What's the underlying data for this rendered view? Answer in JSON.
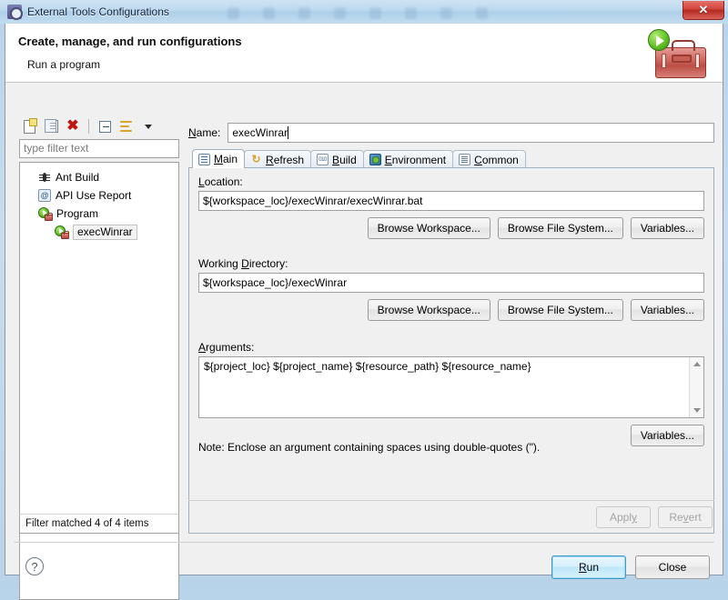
{
  "window": {
    "title": "External Tools Configurations",
    "title_icon": "external-tools-icon",
    "close_label": "✕"
  },
  "banner": {
    "title": "Create, manage, and run configurations",
    "subtitle": "Run a program",
    "art_icon": "toolbox-with-play-icon"
  },
  "tree_toolbar": {
    "buttons": [
      {
        "name": "new-launch-configuration",
        "icon": "new-document-icon"
      },
      {
        "name": "duplicate-launch-configuration",
        "icon": "copy-icon"
      },
      {
        "name": "delete-launch-configuration",
        "icon": "delete-red-x-icon",
        "glyph": "✖"
      },
      {
        "name": "collapse-all",
        "icon": "collapse-all-icon"
      },
      {
        "name": "filter-launch-configurations",
        "icon": "filter-icon"
      },
      {
        "name": "view-menu",
        "icon": "chevron-down-icon"
      }
    ]
  },
  "filter": {
    "placeholder": "type filter text",
    "value": ""
  },
  "tree": {
    "items": [
      {
        "label": "Ant Build",
        "icon": "ant-icon",
        "indent": 0,
        "selected": false
      },
      {
        "label": "API Use Report",
        "icon": "api-use-report-icon",
        "indent": 0,
        "selected": false,
        "glyph": "@"
      },
      {
        "label": "Program",
        "icon": "program-icon",
        "indent": 0,
        "selected": false
      },
      {
        "label": "execWinrar",
        "icon": "program-icon",
        "indent": 1,
        "selected": true
      }
    ],
    "status": "Filter matched 4 of 4 items"
  },
  "config": {
    "name_label": "Name:",
    "name_label_mnemonic": "N",
    "name_value": "execWinrar",
    "tabs": [
      {
        "label": "Main",
        "icon": "main-tab-icon",
        "active": true,
        "mnemonic": "M"
      },
      {
        "label": "Refresh",
        "icon": "refresh-tab-icon",
        "active": false,
        "mnemonic": "R",
        "glyph": "↻"
      },
      {
        "label": "Build",
        "icon": "build-tab-icon",
        "active": false,
        "mnemonic": "B",
        "glyph": "010"
      },
      {
        "label": "Environment",
        "icon": "environment-tab-icon",
        "active": false,
        "mnemonic": "E"
      },
      {
        "label": "Common",
        "icon": "common-tab-icon",
        "active": false,
        "mnemonic": "C"
      }
    ],
    "location": {
      "label": "Location:",
      "label_head": "L",
      "label_tail": "ocation:",
      "value": "${workspace_loc}/execWinrar/execWinrar.bat",
      "buttons": [
        {
          "label": "Browse Workspace...",
          "name": "browse-workspace-location-button"
        },
        {
          "label": "Browse File System...",
          "name": "browse-file-system-location-button"
        },
        {
          "label": "Variables...",
          "name": "variables-location-button"
        }
      ]
    },
    "working_directory": {
      "label": "Working Directory:",
      "value": "${workspace_loc}/execWinrar",
      "buttons": [
        {
          "label": "Browse Workspace...",
          "name": "browse-workspace-workdir-button"
        },
        {
          "label": "Browse File System...",
          "name": "browse-file-system-workdir-button"
        },
        {
          "label": "Variables...",
          "name": "variables-workdir-button"
        }
      ]
    },
    "arguments": {
      "label": "Arguments:",
      "value": "${project_loc} ${project_name} ${resource_path} ${resource_name}",
      "variables_button": "Variables...",
      "note": "Note: Enclose an argument containing spaces using double-quotes (\")."
    }
  },
  "actions": {
    "apply": {
      "label": "Apply",
      "enabled": false
    },
    "revert": {
      "label": "Revert",
      "enabled": false
    },
    "run": {
      "label": "Run",
      "default": true,
      "mnemonic": "R"
    },
    "close": {
      "label": "Close",
      "default": false
    },
    "help": {
      "icon": "help-question-icon",
      "glyph": "?"
    }
  },
  "colors": {
    "titlebar": "#bcd8ee",
    "close_button": "#c9342b",
    "dialog_bg": "#f0f0f0",
    "field_bg": "#ffffff",
    "default_button_border": "#3c9cc8",
    "delete_icon": "#c0160f",
    "program_icon_green": "#5dbf22",
    "toolbox_red": "#bb4f45"
  }
}
